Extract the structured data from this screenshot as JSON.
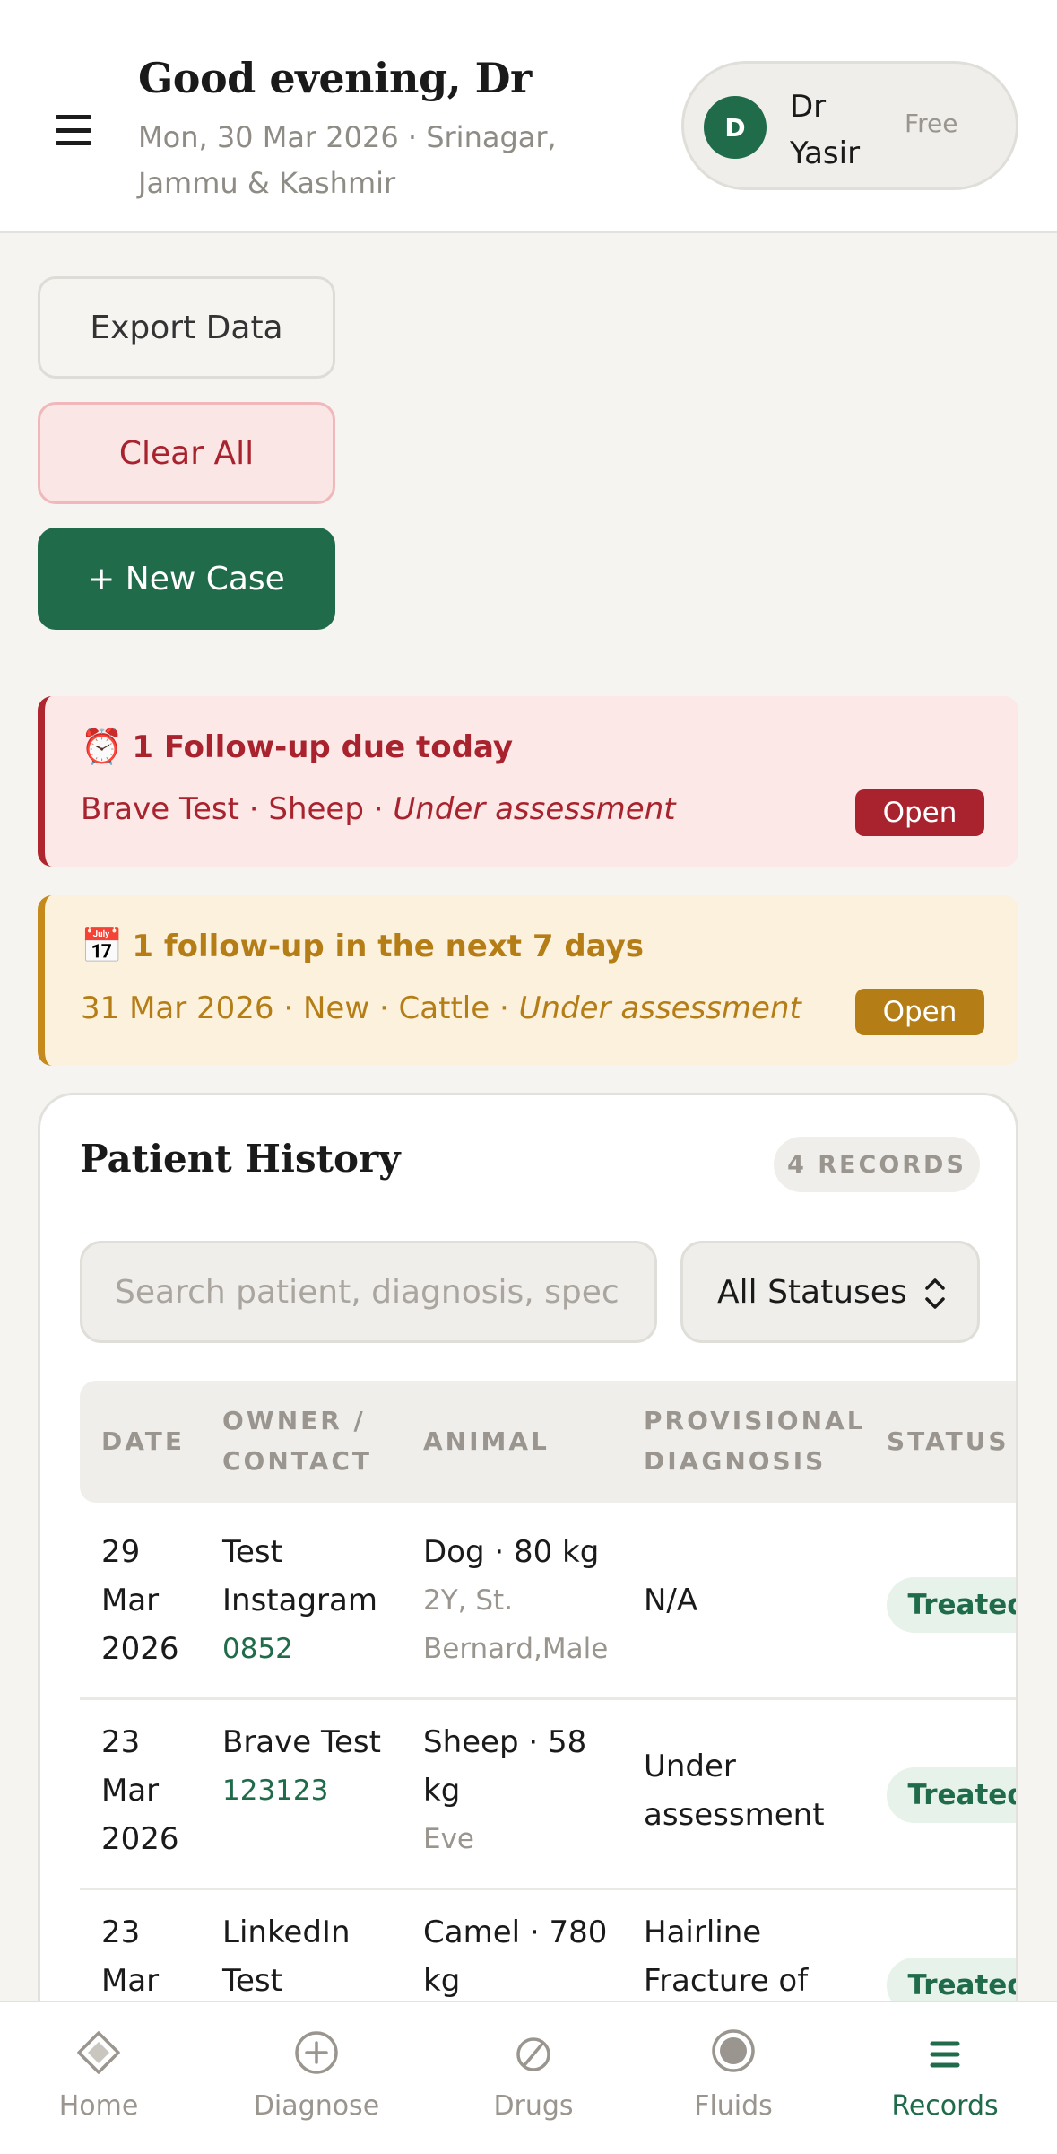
{
  "header": {
    "greeting": "Good evening, Dr",
    "subline": "Mon, 30 Mar 2026 · Srinagar, Jammu & Kashmir",
    "profile": {
      "initial": "D",
      "name": "Dr Yasir",
      "plan": "Free"
    }
  },
  "actions": {
    "export_label": "Export Data",
    "clear_label": "Clear All",
    "new_case_label": "+ New Case"
  },
  "alerts": {
    "today": {
      "icon": "⏰",
      "title": "1 Follow-up due today",
      "line_prefix": "Brave Test · Sheep · ",
      "line_status": "Under assessment",
      "button": "Open"
    },
    "upcoming": {
      "icon": "📅",
      "title": "1 follow-up in the next 7 days",
      "line_prefix": "31 Mar 2026 · New · Cattle · ",
      "line_status": "Under assessment",
      "button": "Open"
    }
  },
  "history": {
    "title": "Patient History",
    "records_badge": "4 RECORDS",
    "search_placeholder": "Search patient, diagnosis, speci",
    "status_filter": "All Statuses",
    "columns": {
      "date": "DATE",
      "owner": "OWNER / CONTACT",
      "animal": "ANIMAL",
      "diagnosis": "PROVISIONAL DIAGNOSIS",
      "status": "STATUS"
    },
    "rows": [
      {
        "date": "29 Mar 2026",
        "owner": "Test Instagram",
        "contact": "0852",
        "animal": "Dog · 80 kg",
        "animal_detail": "2Y, St. Bernard,Male",
        "diagnosis": "N/A",
        "status": "Treated"
      },
      {
        "date": "23 Mar 2026",
        "owner": "Brave Test",
        "contact": "123123",
        "animal": "Sheep · 58 kg",
        "animal_detail": "Eve",
        "diagnosis": "Under assessment",
        "status": "Treated"
      },
      {
        "date": "23 Mar",
        "owner": "LinkedIn Test",
        "contact": "",
        "animal": "Camel · 780 kg",
        "animal_detail": "",
        "diagnosis": "Hairline Fracture of",
        "status": "Treated"
      }
    ]
  },
  "nav": {
    "items": [
      {
        "label": "Home",
        "icon": "diamond-icon"
      },
      {
        "label": "Diagnose",
        "icon": "plus-circle-icon"
      },
      {
        "label": "Drugs",
        "icon": "pill-icon"
      },
      {
        "label": "Fluids",
        "icon": "drop-circle-icon"
      },
      {
        "label": "Records",
        "icon": "list-icon"
      }
    ],
    "active": "Records"
  },
  "colors": {
    "brand_green": "#1f6b4a",
    "alert_red": "#a8232e",
    "alert_amber": "#b57d16",
    "background": "#f5f4f0"
  }
}
